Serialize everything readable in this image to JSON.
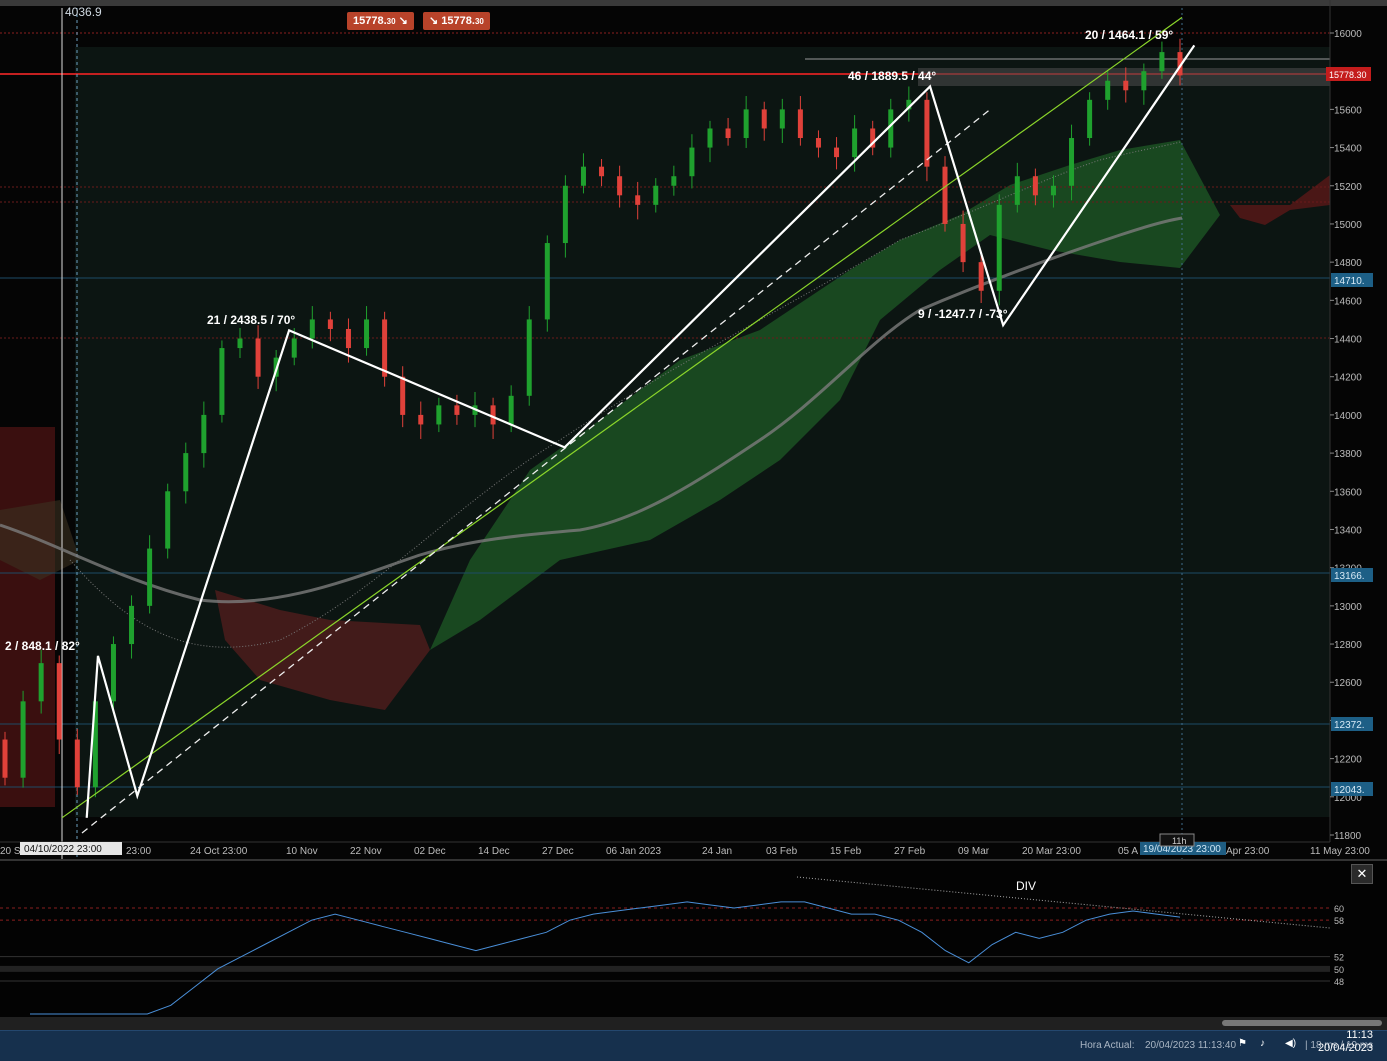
{
  "topbar": {
    "value": "4036.9",
    "sell_label": "15778.",
    "sell_sub": "30",
    "buy_label": "15778.",
    "buy_sub": "30"
  },
  "colors": {
    "bull": "#1fa12e",
    "bear": "#e0413a",
    "cloud_up": "#1d5a25",
    "cloud_down": "#5a1e1e",
    "accent": "#8bd62a"
  },
  "chart_data": {
    "type": "candlestick",
    "title": "",
    "ylim": [
      11800,
      16000
    ],
    "y_ticks": [
      "16000",
      "15800",
      "15600",
      "15400",
      "15200",
      "15000",
      "14800",
      "14600",
      "14400",
      "14200",
      "14000",
      "13800",
      "13600",
      "13400",
      "13200",
      "13000",
      "12800",
      "12600",
      "12400",
      "12200",
      "12000",
      "11800"
    ],
    "x_ticks": [
      "20 S",
      "24 Oct 23:00",
      "10 Nov",
      "22 Nov",
      "02 Dec",
      "14 Dec",
      "27 Dec",
      "06 Jan 2023",
      "24 Jan",
      "03 Feb",
      "15 Feb",
      "27 Feb",
      "09 Mar",
      "20 Mar 23:00",
      "05 A",
      "Apr 23:00",
      "11 May 23:00"
    ],
    "x_partial": "23:00",
    "cursor_date": "04/10/2022 23:00",
    "current_date": "19/04/2023 23:00",
    "current_price": "15778.30",
    "price_badges": [
      "14710.",
      "13166.",
      "12372.",
      "12043."
    ],
    "countdown": "11h",
    "annotations": [
      {
        "text": "2 / 848.1 / 82°"
      },
      {
        "text": "21 / 2438.5 / 70°"
      },
      {
        "text": "46 / 1889.5 / 44°"
      },
      {
        "text": "9 / -1247.7 / -73°"
      },
      {
        "text": "20 / 1464.1 / 59°"
      }
    ],
    "close_series": [
      12100,
      12500,
      12700,
      12300,
      12050,
      12500,
      12800,
      13000,
      13300,
      13600,
      13800,
      14000,
      14350,
      14400,
      14200,
      14300,
      14400,
      14500,
      14450,
      14350,
      14500,
      14200,
      14000,
      13950,
      14050,
      14000,
      14050,
      13950,
      14100,
      14500,
      14900,
      15200,
      15300,
      15250,
      15150,
      15100,
      15200,
      15250,
      15400,
      15500,
      15450,
      15600,
      15500,
      15600,
      15450,
      15400,
      15350,
      15500,
      15400,
      15600,
      15650,
      15300,
      15000,
      14800,
      14650,
      15100,
      15250,
      15150,
      15200,
      15450,
      15650,
      15750,
      15700,
      15800,
      15900,
      15778
    ],
    "zigzag": [
      {
        "date": "2022-10-04",
        "price": 11890
      },
      {
        "date": "2022-10-06",
        "price": 12738
      },
      {
        "date": "2022-10-13",
        "price": 12005
      },
      {
        "date": "2022-11-09",
        "price": 14443
      },
      {
        "date": "2022-12-28",
        "price": 13830
      },
      {
        "date": "2023-03-03",
        "price": 15720
      },
      {
        "date": "2023-03-16",
        "price": 14470
      },
      {
        "date": "2023-04-19",
        "price": 15935
      }
    ],
    "indicator": {
      "label": "DIV",
      "levels": [
        "60",
        "58",
        "52",
        "50",
        "48"
      ],
      "values": [
        22,
        25,
        28,
        32,
        36,
        40,
        44,
        47,
        50,
        52,
        54,
        56,
        58,
        59,
        58,
        57,
        56,
        55,
        54,
        53,
        54,
        55,
        56,
        58,
        59,
        59.5,
        60,
        60.5,
        61,
        60.5,
        60,
        60.5,
        61,
        61,
        60,
        59,
        59,
        58,
        56,
        53,
        51,
        54,
        56,
        55,
        56,
        58,
        59,
        59.5,
        59,
        58.5
      ]
    }
  },
  "statusbar": {
    "label": "Hora Actual:",
    "datetime": "20/04/2023 11:13:40",
    "latency": "| 18 ms / 19 ms",
    "clock_time": "11:13",
    "clock_date": "20/04/2023"
  }
}
